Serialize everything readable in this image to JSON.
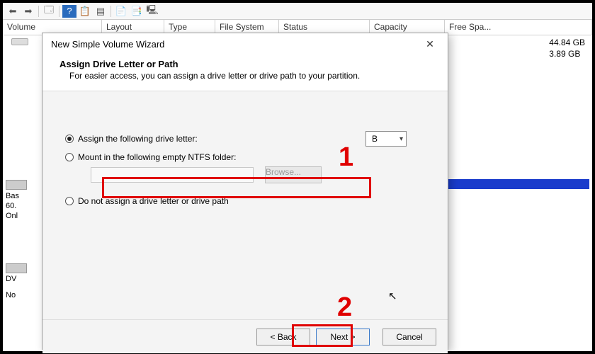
{
  "toolbar": {
    "back": "⬅",
    "fwd": "➡",
    "up": "⬆",
    "refresh": "🗔",
    "help": "?",
    "props": "📋",
    "list": "▤",
    "add": "+",
    "gear": "⚙"
  },
  "columns": {
    "volume": "Volume",
    "layout": "Layout",
    "type": "Type",
    "filesystem": "File System",
    "status": "Status",
    "capacity": "Capacity",
    "freespace": "Free Spa..."
  },
  "freespace_values": [
    "44.84 GB",
    "3.89 GB"
  ],
  "lower": {
    "bas": "Bas",
    "size": "60.",
    "onl": "Onl"
  },
  "dv": "DV",
  "no": "No",
  "dialog": {
    "title": "New Simple Volume Wizard",
    "heading": "Assign Drive Letter or Path",
    "subtext": "For easier access, you can assign a drive letter or drive path to your partition.",
    "opt1": "Assign the following drive letter:",
    "opt2": "Mount in the following empty NTFS folder:",
    "opt3": "Do not assign a drive letter or drive path",
    "drive_letter": "B",
    "browse": "Browse...",
    "back": "< Back",
    "next": "Next >",
    "cancel": "Cancel"
  },
  "annot": {
    "one": "1",
    "two": "2"
  }
}
